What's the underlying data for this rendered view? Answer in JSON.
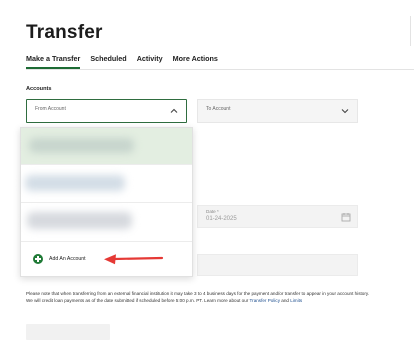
{
  "header": {
    "title": "Transfer"
  },
  "tabs": [
    {
      "label": "Make a Transfer",
      "active": true
    },
    {
      "label": "Scheduled",
      "active": false
    },
    {
      "label": "Activity",
      "active": false
    },
    {
      "label": "More Actions",
      "active": false
    }
  ],
  "form": {
    "accounts_label": "Accounts",
    "from_account_label": "From Account",
    "to_account_label": "To Account",
    "date_label": "Date *",
    "date_value": "01-24-2025"
  },
  "dropdown": {
    "options_blurred": 3,
    "add_account_label": "Add An Account"
  },
  "notice": {
    "text": "Please note that when transferring from an external financial institution it may take 3 to 4 business days for the payment and/or transfer to appear in your account history. We will credit loan payments as of the date submitted if scheduled before 5:00 p.m. PT. Learn more about our ",
    "link1": "Transfer Policy",
    "joiner": " and ",
    "link2": "Limits"
  },
  "colors": {
    "accent_green": "#1f7a36",
    "focus_border": "#2f6d3f",
    "selected_option_bg": "#e3eee1",
    "annotation_red": "#e53935",
    "link_blue": "#1e4f8f"
  },
  "icons": [
    "chevron-up-icon",
    "chevron-down-icon",
    "plus-circle-icon",
    "calendar-icon",
    "arrow-annotation-icon"
  ]
}
